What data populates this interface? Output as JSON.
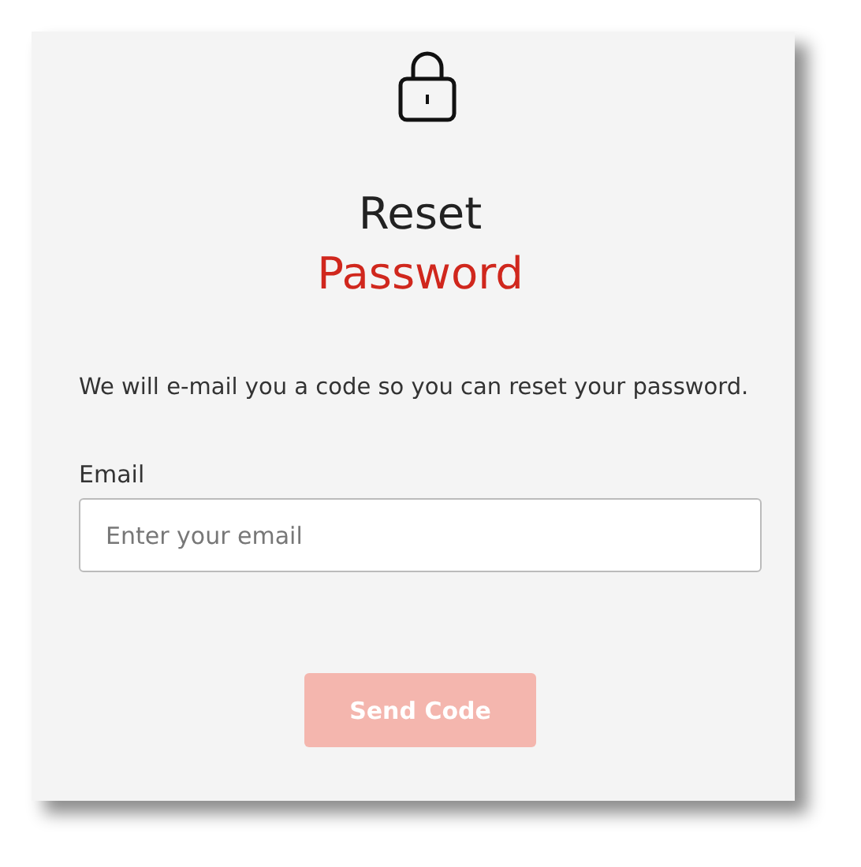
{
  "title": {
    "line_1": "Reset",
    "line_2": "Password"
  },
  "description": "We will e-mail you a code so you can reset your password.",
  "email": {
    "label": "Email",
    "placeholder": "Enter your email"
  },
  "button": {
    "label": "Send Code",
    "disabled": true
  }
}
